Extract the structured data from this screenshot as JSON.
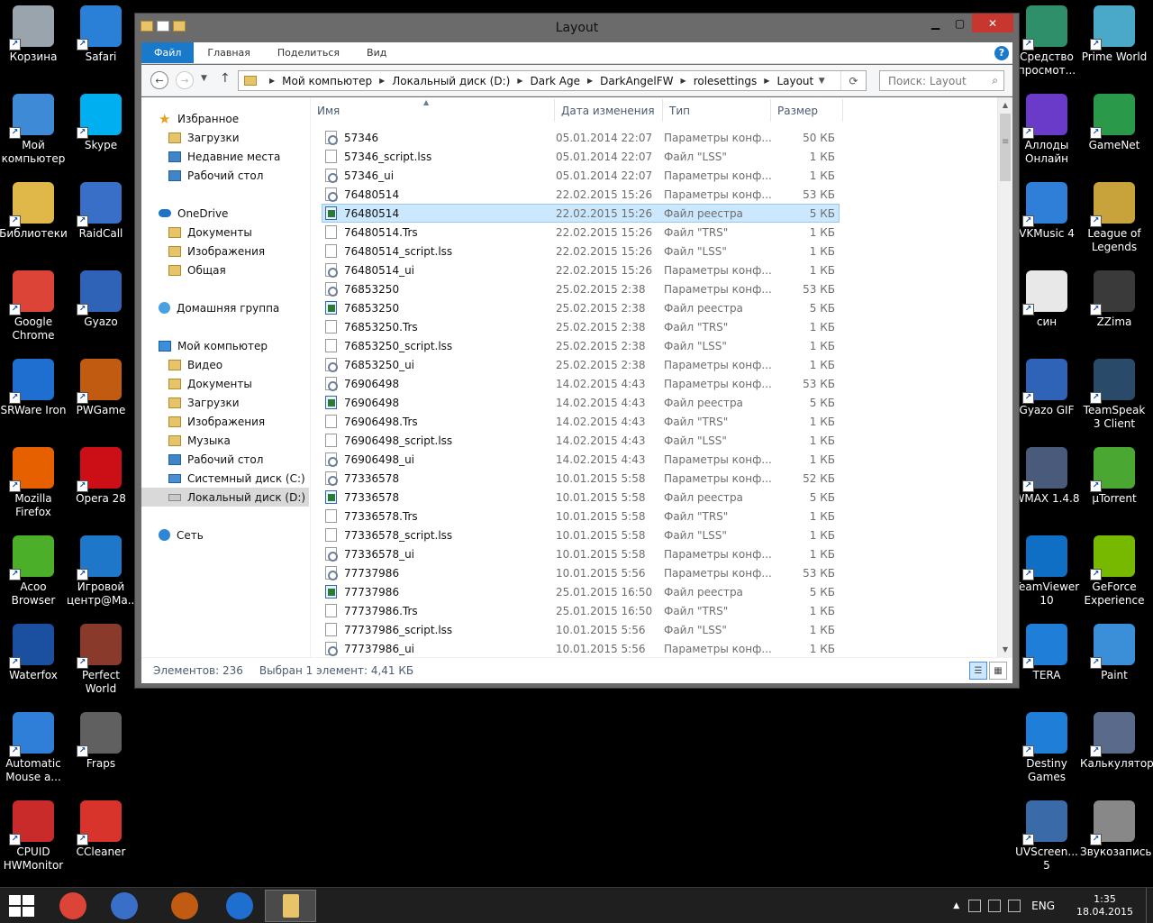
{
  "desktop_left": [
    {
      "label": "Корзина",
      "icon": "recycle-bin-icon",
      "color": "#9aa4ad"
    },
    {
      "label": "Safari",
      "icon": "safari-icon",
      "color": "#2a7fd6"
    },
    {
      "label": "Мой компьютер",
      "icon": "computer-icon",
      "color": "#3f8ad6"
    },
    {
      "label": "Skype",
      "icon": "skype-icon",
      "color": "#00aff0"
    },
    {
      "label": "Библиотеки",
      "icon": "libraries-icon",
      "color": "#e0b84a"
    },
    {
      "label": "RaidCall",
      "icon": "raidcall-icon",
      "color": "#3a6fc8"
    },
    {
      "label": "Google Chrome",
      "icon": "chrome-icon",
      "color": "#db4437"
    },
    {
      "label": "Gyazo",
      "icon": "gyazo-icon",
      "color": "#2e63b8"
    },
    {
      "label": "SRWare Iron",
      "icon": "srware-iron-icon",
      "color": "#1f6fd1"
    },
    {
      "label": "PWGame",
      "icon": "pwgame-icon",
      "color": "#c25b12"
    },
    {
      "label": "Mozilla Firefox",
      "icon": "firefox-icon",
      "color": "#e66000"
    },
    {
      "label": "Opera 28",
      "icon": "opera-icon",
      "color": "#cc0f16"
    },
    {
      "label": "Acoo Browser",
      "icon": "acoo-browser-icon",
      "color": "#4caf2a"
    },
    {
      "label": "Игровой центр@Ma...",
      "icon": "game-center-icon",
      "color": "#1f77c9"
    },
    {
      "label": "Waterfox",
      "icon": "waterfox-icon",
      "color": "#1b4fa0"
    },
    {
      "label": "Perfect World",
      "icon": "perfect-world-icon",
      "color": "#8a3a2a"
    },
    {
      "label": "Automatic Mouse a...",
      "icon": "automatic-mouse-icon",
      "color": "#2f7fd8"
    },
    {
      "label": "Fraps",
      "icon": "fraps-icon",
      "color": "#606060"
    },
    {
      "label": "CPUID HWMonitor",
      "icon": "hwmonitor-icon",
      "color": "#c92a2a"
    },
    {
      "label": "CCleaner",
      "icon": "ccleaner-icon",
      "color": "#d9342b"
    }
  ],
  "desktop_right": [
    {
      "label": "Средство просмот...",
      "icon": "viewer-tool-icon",
      "color": "#2f8f6a"
    },
    {
      "label": "Prime World",
      "icon": "prime-world-icon",
      "color": "#4aa8c8"
    },
    {
      "label": "Аллоды Онлайн",
      "icon": "allods-online-icon",
      "color": "#6a3ac8"
    },
    {
      "label": "GameNet",
      "icon": "gamenet-icon",
      "color": "#2a9a4a"
    },
    {
      "label": "VKMusic 4",
      "icon": "vkmusic-icon",
      "color": "#2f7fd8"
    },
    {
      "label": "League of Legends",
      "icon": "league-of-legends-icon",
      "color": "#c8a23a"
    },
    {
      "label": "син",
      "icon": "text-file-icon",
      "color": "#e8e8e8"
    },
    {
      "label": "ZZima",
      "icon": "zzima-icon",
      "color": "#3a3a3a"
    },
    {
      "label": "Gyazo GIF",
      "icon": "gyazo-gif-icon",
      "color": "#2e63b8"
    },
    {
      "label": "TeamSpeak 3 Client",
      "icon": "teamspeak-icon",
      "color": "#2a4a6a"
    },
    {
      "label": "WMAX 1.4.8",
      "icon": "wmax-icon",
      "color": "#4a5a7a"
    },
    {
      "label": "µTorrent",
      "icon": "utorrent-icon",
      "color": "#4aa832"
    },
    {
      "label": "TeamViewer 10",
      "icon": "teamviewer-icon",
      "color": "#0e6fc4"
    },
    {
      "label": "GeForce Experience",
      "icon": "geforce-icon",
      "color": "#76b900"
    },
    {
      "label": "TERA",
      "icon": "tera-icon",
      "color": "#1f7fd8"
    },
    {
      "label": "Paint",
      "icon": "paint-icon",
      "color": "#3a8fd8"
    },
    {
      "label": "Destiny Games",
      "icon": "destiny-games-icon",
      "color": "#1f7fd8"
    },
    {
      "label": "Калькулятор",
      "icon": "calculator-icon",
      "color": "#5a6a8a"
    },
    {
      "label": "UVScreen... 5",
      "icon": "uvscreen-icon",
      "color": "#3a6aa8"
    },
    {
      "label": "Звукозапись",
      "icon": "microphone-icon",
      "color": "#888888"
    }
  ],
  "window": {
    "title": "Layout",
    "minimize": "▁",
    "maximize": "▢",
    "close": "✕",
    "ribbon_tabs": [
      "Файл",
      "Главная",
      "Поделиться",
      "Вид"
    ],
    "help": "?",
    "breadcrumb": [
      "Мой компьютер",
      "Локальный диск (D:)",
      "Dark Age",
      "DarkAngelFW",
      "rolesettings",
      "Layout"
    ],
    "search_placeholder": "Поиск: Layout"
  },
  "nav": {
    "favorites": {
      "label": "Избранное",
      "items": [
        "Загрузки",
        "Недавние места",
        "Рабочий стол"
      ]
    },
    "onedrive": {
      "label": "OneDrive",
      "items": [
        "Документы",
        "Изображения",
        "Общая"
      ]
    },
    "homegroup": {
      "label": "Домашняя группа"
    },
    "computer": {
      "label": "Мой компьютер",
      "items": [
        "Видео",
        "Документы",
        "Загрузки",
        "Изображения",
        "Музыка",
        "Рабочий стол",
        "Системный диск (C:)",
        "Локальный диск (D:)"
      ]
    },
    "network": {
      "label": "Сеть"
    }
  },
  "columns": {
    "name": "Имя",
    "date": "Дата изменения",
    "type": "Тип",
    "size": "Размер"
  },
  "files": [
    {
      "name": "57346",
      "date": "05.01.2014 22:07",
      "type": "Параметры конф...",
      "size": "50 КБ",
      "icon": "cfg"
    },
    {
      "name": "57346_script.lss",
      "date": "05.01.2014 22:07",
      "type": "Файл \"LSS\"",
      "size": "1 КБ",
      "icon": "plain"
    },
    {
      "name": "57346_ui",
      "date": "05.01.2014 22:07",
      "type": "Параметры конф...",
      "size": "1 КБ",
      "icon": "cfg"
    },
    {
      "name": "76480514",
      "date": "22.02.2015 15:26",
      "type": "Параметры конф...",
      "size": "53 КБ",
      "icon": "cfg"
    },
    {
      "name": "76480514",
      "date": "22.02.2015 15:26",
      "type": "Файл реестра",
      "size": "5 КБ",
      "icon": "reg",
      "selected": true
    },
    {
      "name": "76480514.Trs",
      "date": "22.02.2015 15:26",
      "type": "Файл \"TRS\"",
      "size": "1 КБ",
      "icon": "plain"
    },
    {
      "name": "76480514_script.lss",
      "date": "22.02.2015 15:26",
      "type": "Файл \"LSS\"",
      "size": "1 КБ",
      "icon": "plain"
    },
    {
      "name": "76480514_ui",
      "date": "22.02.2015 15:26",
      "type": "Параметры конф...",
      "size": "1 КБ",
      "icon": "cfg"
    },
    {
      "name": "76853250",
      "date": "25.02.2015 2:38",
      "type": "Параметры конф...",
      "size": "53 КБ",
      "icon": "cfg"
    },
    {
      "name": "76853250",
      "date": "25.02.2015 2:38",
      "type": "Файл реестра",
      "size": "5 КБ",
      "icon": "reg"
    },
    {
      "name": "76853250.Trs",
      "date": "25.02.2015 2:38",
      "type": "Файл \"TRS\"",
      "size": "1 КБ",
      "icon": "plain"
    },
    {
      "name": "76853250_script.lss",
      "date": "25.02.2015 2:38",
      "type": "Файл \"LSS\"",
      "size": "1 КБ",
      "icon": "plain"
    },
    {
      "name": "76853250_ui",
      "date": "25.02.2015 2:38",
      "type": "Параметры конф...",
      "size": "1 КБ",
      "icon": "cfg"
    },
    {
      "name": "76906498",
      "date": "14.02.2015 4:43",
      "type": "Параметры конф...",
      "size": "53 КБ",
      "icon": "cfg"
    },
    {
      "name": "76906498",
      "date": "14.02.2015 4:43",
      "type": "Файл реестра",
      "size": "5 КБ",
      "icon": "reg"
    },
    {
      "name": "76906498.Trs",
      "date": "14.02.2015 4:43",
      "type": "Файл \"TRS\"",
      "size": "1 КБ",
      "icon": "plain"
    },
    {
      "name": "76906498_script.lss",
      "date": "14.02.2015 4:43",
      "type": "Файл \"LSS\"",
      "size": "1 КБ",
      "icon": "plain"
    },
    {
      "name": "76906498_ui",
      "date": "14.02.2015 4:43",
      "type": "Параметры конф...",
      "size": "1 КБ",
      "icon": "cfg"
    },
    {
      "name": "77336578",
      "date": "10.01.2015 5:58",
      "type": "Параметры конф...",
      "size": "52 КБ",
      "icon": "cfg"
    },
    {
      "name": "77336578",
      "date": "10.01.2015 5:58",
      "type": "Файл реестра",
      "size": "5 КБ",
      "icon": "reg"
    },
    {
      "name": "77336578.Trs",
      "date": "10.01.2015 5:58",
      "type": "Файл \"TRS\"",
      "size": "1 КБ",
      "icon": "plain"
    },
    {
      "name": "77336578_script.lss",
      "date": "10.01.2015 5:58",
      "type": "Файл \"LSS\"",
      "size": "1 КБ",
      "icon": "plain"
    },
    {
      "name": "77336578_ui",
      "date": "10.01.2015 5:58",
      "type": "Параметры конф...",
      "size": "1 КБ",
      "icon": "cfg"
    },
    {
      "name": "77737986",
      "date": "10.01.2015 5:56",
      "type": "Параметры конф...",
      "size": "53 КБ",
      "icon": "cfg"
    },
    {
      "name": "77737986",
      "date": "25.01.2015 16:50",
      "type": "Файл реестра",
      "size": "5 КБ",
      "icon": "reg"
    },
    {
      "name": "77737986.Trs",
      "date": "25.01.2015 16:50",
      "type": "Файл \"TRS\"",
      "size": "1 КБ",
      "icon": "plain"
    },
    {
      "name": "77737986_script.lss",
      "date": "10.01.2015 5:56",
      "type": "Файл \"LSS\"",
      "size": "1 КБ",
      "icon": "plain"
    },
    {
      "name": "77737986_ui",
      "date": "10.01.2015 5:56",
      "type": "Параметры конф...",
      "size": "1 КБ",
      "icon": "cfg"
    }
  ],
  "status": {
    "count": "Элементов: 236",
    "selection": "Выбран 1 элемент: 4,41 КБ"
  },
  "taskbar": {
    "items": [
      {
        "name": "chrome-taskbar-icon",
        "color": "#db4437"
      },
      {
        "name": "raidcall-taskbar-icon",
        "color": "#3a6fc8"
      },
      {
        "name": "pwgame-taskbar-icon",
        "color": "#c25b12"
      },
      {
        "name": "srware-iron-taskbar-icon",
        "color": "#1f6fd1"
      },
      {
        "name": "explorer-taskbar-icon",
        "color": "#e7c46a",
        "active": true
      }
    ],
    "lang": "ENG",
    "time": "1:35",
    "date": "18.04.2015"
  }
}
